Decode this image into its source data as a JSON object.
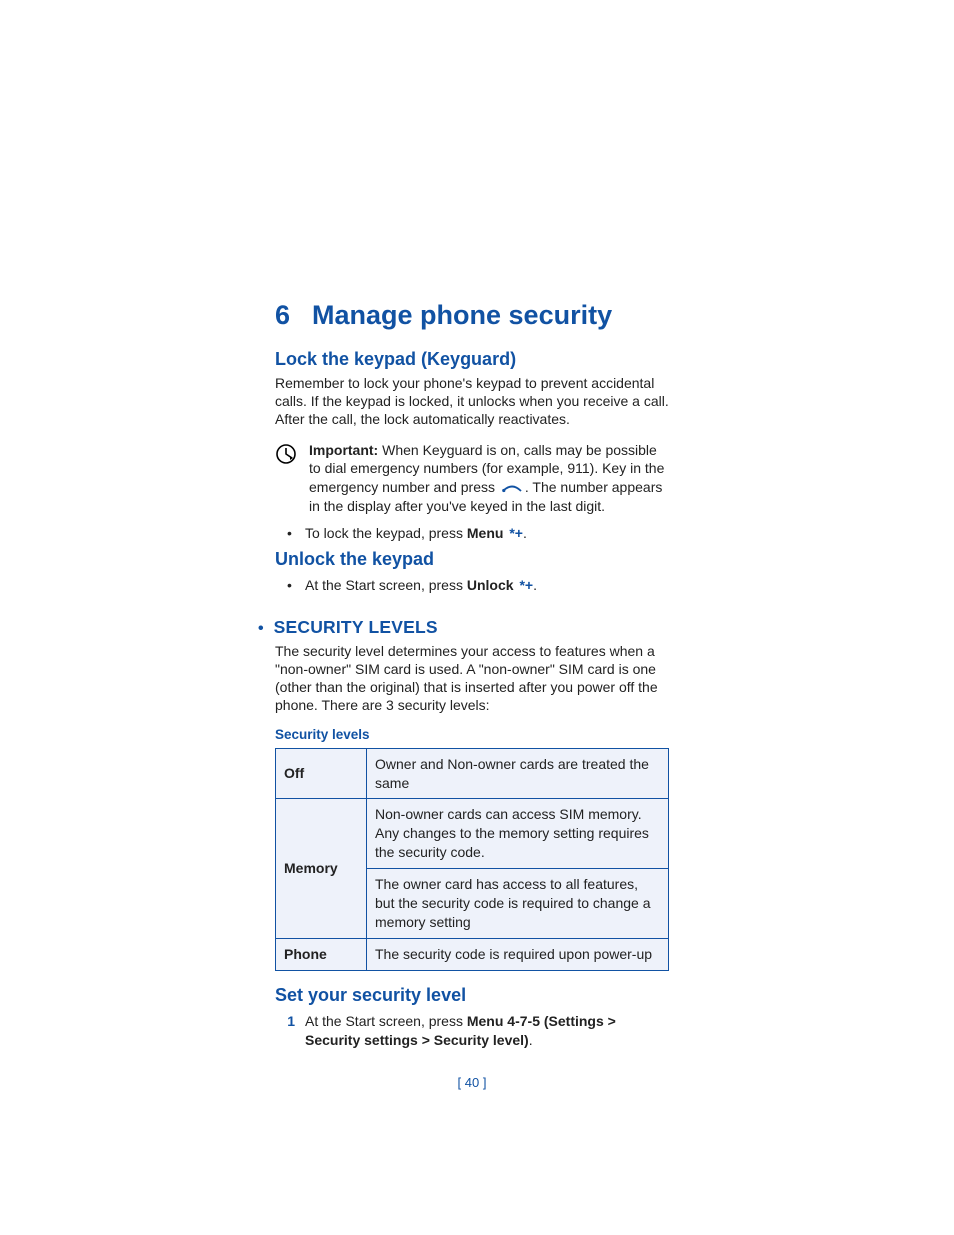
{
  "chapter": {
    "number": "6",
    "title": "Manage phone security"
  },
  "sections": {
    "lock": {
      "heading": "Lock the keypad (Keyguard)",
      "intro": "Remember to lock your phone's keypad to prevent accidental calls. If the keypad is locked, it unlocks when you receive a call. After the call, the lock automatically reactivates.",
      "important_label": "Important:",
      "important_before": "When Keyguard is on, calls may be possible to dial emergency numbers (for example, 911). Key in the emergency number and press ",
      "important_after": ". The number appears in the display after you've keyed in the last digit.",
      "bullet_before": "To lock the keypad, press ",
      "bullet_key": "Menu",
      "bullet_star": "*+",
      "bullet_after": "."
    },
    "unlock": {
      "heading": "Unlock the keypad",
      "bullet_before": "At the Start screen, press ",
      "bullet_key": "Unlock",
      "bullet_star": "*+",
      "bullet_after": "."
    },
    "levels": {
      "title": "SECURITY LEVELS",
      "intro": "The security level determines your access to features when a \"non-owner\" SIM card is used. A \"non-owner\" SIM card is one (other than the original) that is inserted after you power off the phone. There are 3 security levels:",
      "table_caption": "Security levels",
      "rows": {
        "off": {
          "label": "Off",
          "desc": "Owner and Non-owner cards are treated the same"
        },
        "mem1": {
          "desc": "Non-owner cards can access SIM memory. Any changes to the memory setting requires the security code."
        },
        "mem": {
          "label": "Memory"
        },
        "mem2": {
          "desc": "The owner card has access to all features, but the security code is required to change a memory setting"
        },
        "phone": {
          "label": "Phone",
          "desc": "The security code is required upon power-up"
        }
      }
    },
    "set": {
      "heading": "Set your security level",
      "step1_before": "At the Start screen, press ",
      "step1_bold": "Menu 4-7-5 (Settings > Security settings > Security level)",
      "step1_after": "."
    }
  },
  "page_number": "[ 40 ]"
}
